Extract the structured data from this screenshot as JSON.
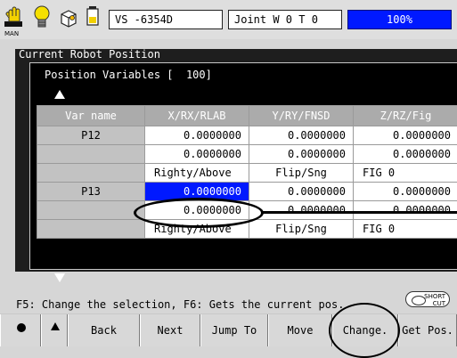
{
  "status_bar": {
    "mode_label": "MAN",
    "robot_field": "VS  -6354D",
    "joint_field": "Joint  W 0 T 0",
    "speed": "100%",
    "colors": {
      "speed_bg": "#0019ff",
      "speed_text": "#ffffff"
    }
  },
  "background_window": {
    "title": "Current Robot Position"
  },
  "dialog": {
    "title": "Position Variables [  100]",
    "columns": [
      "Var name",
      "X/RX/RLAB",
      "Y/RY/FNSD",
      "Z/RZ/Fig"
    ],
    "rows": [
      {
        "name": "P12",
        "x": "0.0000000",
        "y": "0.0000000",
        "z": "0.0000000"
      },
      {
        "name": "",
        "x": "0.0000000",
        "y": "0.0000000",
        "z": "0.0000000"
      },
      {
        "name": "",
        "x": "Righty/Above",
        "y": "Flip/Sng",
        "z": "FIG  0"
      },
      {
        "name": "P13",
        "x": "0.0000000",
        "y": "0.0000000",
        "z": "0.0000000"
      },
      {
        "name": "",
        "x": "0.0000000",
        "y": "0.0000000",
        "z": "0.0000000"
      },
      {
        "name": "",
        "x": "Righty/Above",
        "y": "Flip/Sng",
        "z": "FIG  0"
      }
    ],
    "selected_cell": {
      "row": 3,
      "column": "X/RX/RLAB",
      "color": "#0019ff"
    }
  },
  "hint": "F5: Change the selection, F6: Gets the current pos.",
  "shortcut_badge": {
    "line1": "SHORT",
    "line2": "CUT"
  },
  "function_keys": [
    "Back",
    "Next",
    "Jump To",
    "Move",
    "Change.",
    "Get Pos."
  ]
}
